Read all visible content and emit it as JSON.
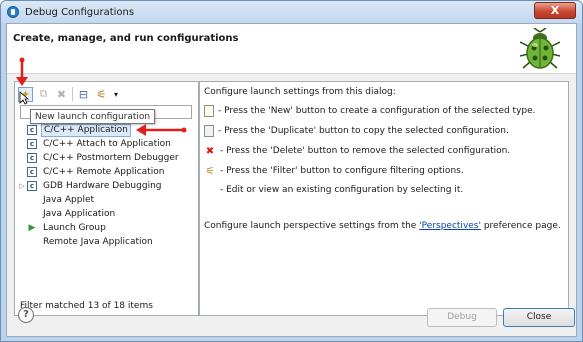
{
  "window": {
    "title": "Debug Configurations",
    "close_symbol": "X"
  },
  "header": {
    "title": "Create, manage, and run configurations"
  },
  "toolbar": {
    "buttons": [
      {
        "icon": "new-launch-config-icon",
        "glyph": "✦"
      },
      {
        "icon": "duplicate-icon",
        "glyph": "⧉"
      },
      {
        "icon": "delete-icon",
        "glyph": "✖"
      },
      {
        "icon": "collapse-all-icon",
        "glyph": "⊟"
      },
      {
        "icon": "filter-icon",
        "glyph": "⚟"
      },
      {
        "icon": "dropdown-icon",
        "glyph": "▾"
      }
    ],
    "tooltip": "New launch configuration"
  },
  "tree": {
    "items": [
      {
        "label": "C/C++ Application",
        "icon": "c",
        "selected": true,
        "expandable": false
      },
      {
        "label": "C/C++ Attach to Application",
        "icon": "c",
        "selected": false,
        "expandable": false
      },
      {
        "label": "C/C++ Postmortem Debugger",
        "icon": "c",
        "selected": false,
        "expandable": false
      },
      {
        "label": "C/C++ Remote Application",
        "icon": "c",
        "selected": false,
        "expandable": false
      },
      {
        "label": "GDB Hardware Debugging",
        "icon": "c",
        "selected": false,
        "expandable": true
      },
      {
        "label": "Java Applet",
        "icon": "",
        "selected": false,
        "expandable": false
      },
      {
        "label": "Java Application",
        "icon": "",
        "selected": false,
        "expandable": false
      },
      {
        "label": "Launch Group",
        "icon": "play",
        "selected": false,
        "expandable": false
      },
      {
        "label": "Remote Java Application",
        "icon": "",
        "selected": false,
        "expandable": false
      }
    ],
    "filter_status": "Filter matched 13 of 18 items"
  },
  "info": {
    "intro": "Configure launch settings from this dialog:",
    "new_line": "- Press the 'New' button to create a configuration of the selected type.",
    "duplicate_line": "- Press the 'Duplicate' button to copy the selected configuration.",
    "delete_line": "- Press the 'Delete' button to remove the selected configuration.",
    "filter_line": "- Press the 'Filter' button to configure filtering options.",
    "edit_line": "- Edit or view an existing configuration by selecting it.",
    "perspective_prefix": "Configure launch perspective settings from the ",
    "perspective_link": "'Perspectives'",
    "perspective_suffix": " preference page."
  },
  "buttons": {
    "help": "?",
    "debug": "Debug",
    "close": "Close"
  },
  "colors": {
    "annotation_red": "#e0201c",
    "selection_bg": "#dce9f8",
    "link": "#0645ad"
  }
}
